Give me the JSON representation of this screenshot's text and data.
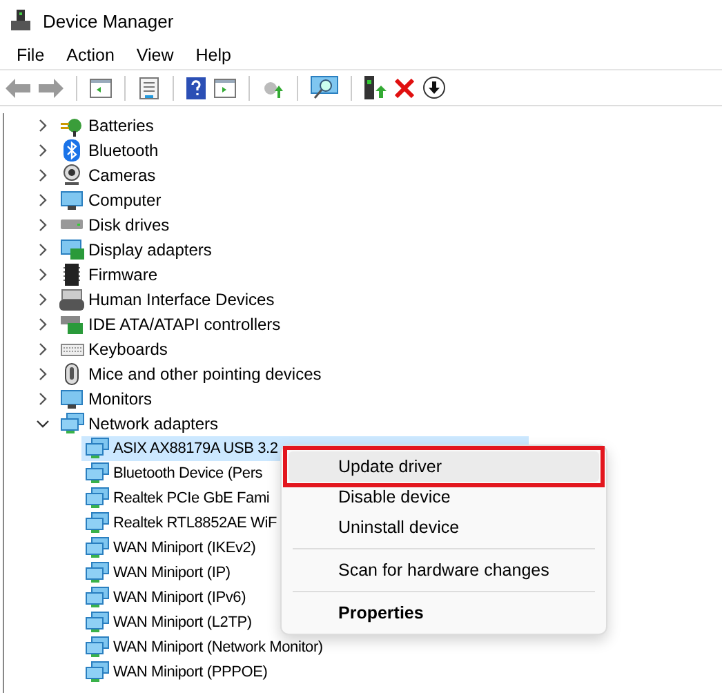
{
  "window": {
    "title": "Device Manager"
  },
  "menu_bar": [
    "File",
    "Action",
    "View",
    "Help"
  ],
  "tree": [
    {
      "label": "Batteries",
      "expanded": false
    },
    {
      "label": "Bluetooth",
      "expanded": false
    },
    {
      "label": "Cameras",
      "expanded": false
    },
    {
      "label": "Computer",
      "expanded": false
    },
    {
      "label": "Disk drives",
      "expanded": false
    },
    {
      "label": "Display adapters",
      "expanded": false
    },
    {
      "label": "Firmware",
      "expanded": false
    },
    {
      "label": "Human Interface Devices",
      "expanded": false
    },
    {
      "label": "IDE ATA/ATAPI controllers",
      "expanded": false
    },
    {
      "label": "Keyboards",
      "expanded": false
    },
    {
      "label": "Mice and other pointing devices",
      "expanded": false
    },
    {
      "label": "Monitors",
      "expanded": false
    },
    {
      "label": "Network adapters",
      "expanded": true,
      "children": [
        {
          "label": "ASIX AX88179A USB 3.2",
          "selected": true
        },
        {
          "label": "Bluetooth Device (Pers",
          "selected": false
        },
        {
          "label": "Realtek PCIe GbE Fami",
          "selected": false
        },
        {
          "label": "Realtek RTL8852AE WiF",
          "selected": false
        },
        {
          "label": "WAN Miniport (IKEv2)",
          "selected": false
        },
        {
          "label": "WAN Miniport (IP)",
          "selected": false
        },
        {
          "label": "WAN Miniport (IPv6)",
          "selected": false
        },
        {
          "label": "WAN Miniport (L2TP)",
          "selected": false
        },
        {
          "label": "WAN Miniport (Network Monitor)",
          "selected": false
        },
        {
          "label": "WAN Miniport (PPPOE)",
          "selected": false
        }
      ]
    }
  ],
  "context_menu": [
    {
      "kind": "item",
      "label": "Update driver",
      "highlighted": true,
      "default": false
    },
    {
      "kind": "item",
      "label": "Disable device",
      "highlighted": false,
      "default": false
    },
    {
      "kind": "item",
      "label": "Uninstall device",
      "highlighted": false,
      "default": false
    },
    {
      "kind": "separator"
    },
    {
      "kind": "item",
      "label": "Scan for hardware changes",
      "highlighted": false,
      "default": false
    },
    {
      "kind": "separator"
    },
    {
      "kind": "item",
      "label": "Properties",
      "highlighted": false,
      "default": true
    }
  ]
}
